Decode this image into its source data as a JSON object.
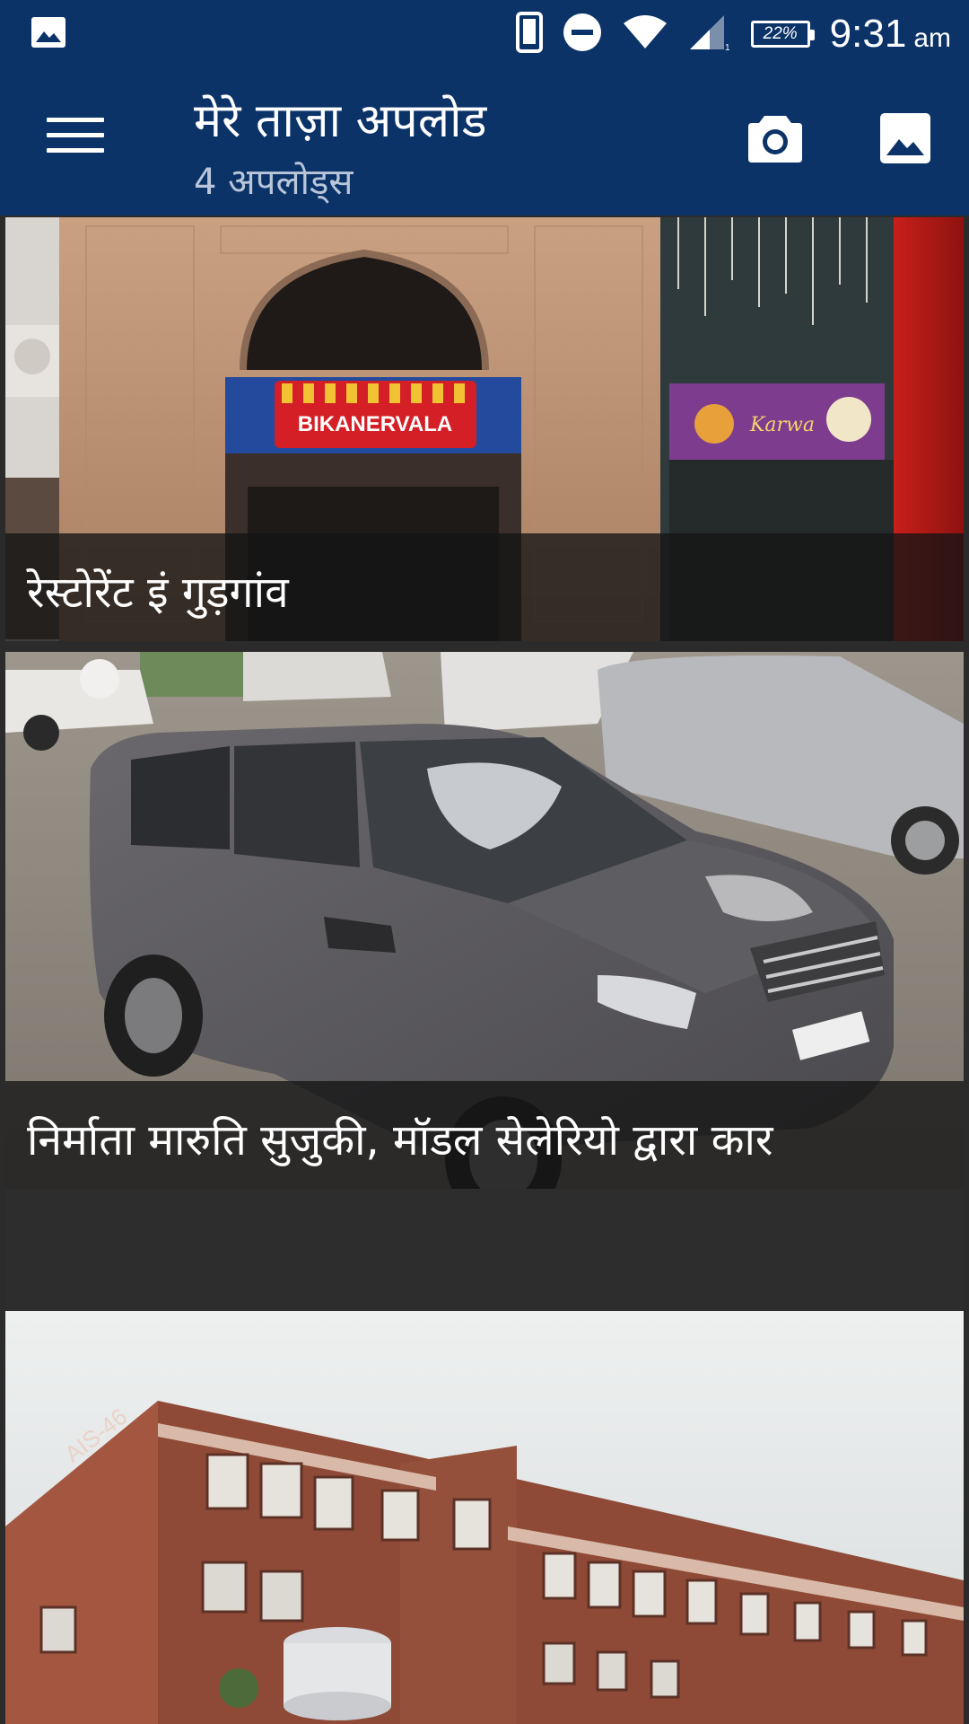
{
  "status_bar": {
    "time": "9:31",
    "ampm": "am",
    "battery": "22%",
    "icons": [
      "image-icon",
      "phone-icon",
      "do-not-disturb-icon",
      "wifi-icon",
      "cell-signal-icon",
      "battery-icon"
    ]
  },
  "app_bar": {
    "title": "मेरे ताज़ा अपलोड",
    "subtitle": "4 अपलोड्स",
    "background": "#0b3368",
    "icons": [
      "menu-icon",
      "camera-icon",
      "gallery-icon"
    ]
  },
  "uploads": [
    {
      "caption": "रेस्टोरेंट इं गुड़गांव",
      "sign_text": "BIKANERVALA",
      "banner_text": "Karwa"
    },
    {
      "caption": "निर्माता मारुति सुजुकी, मॉडल सेलेरियो द्वारा कार"
    },
    {
      "building_text": "AIS-46"
    }
  ]
}
